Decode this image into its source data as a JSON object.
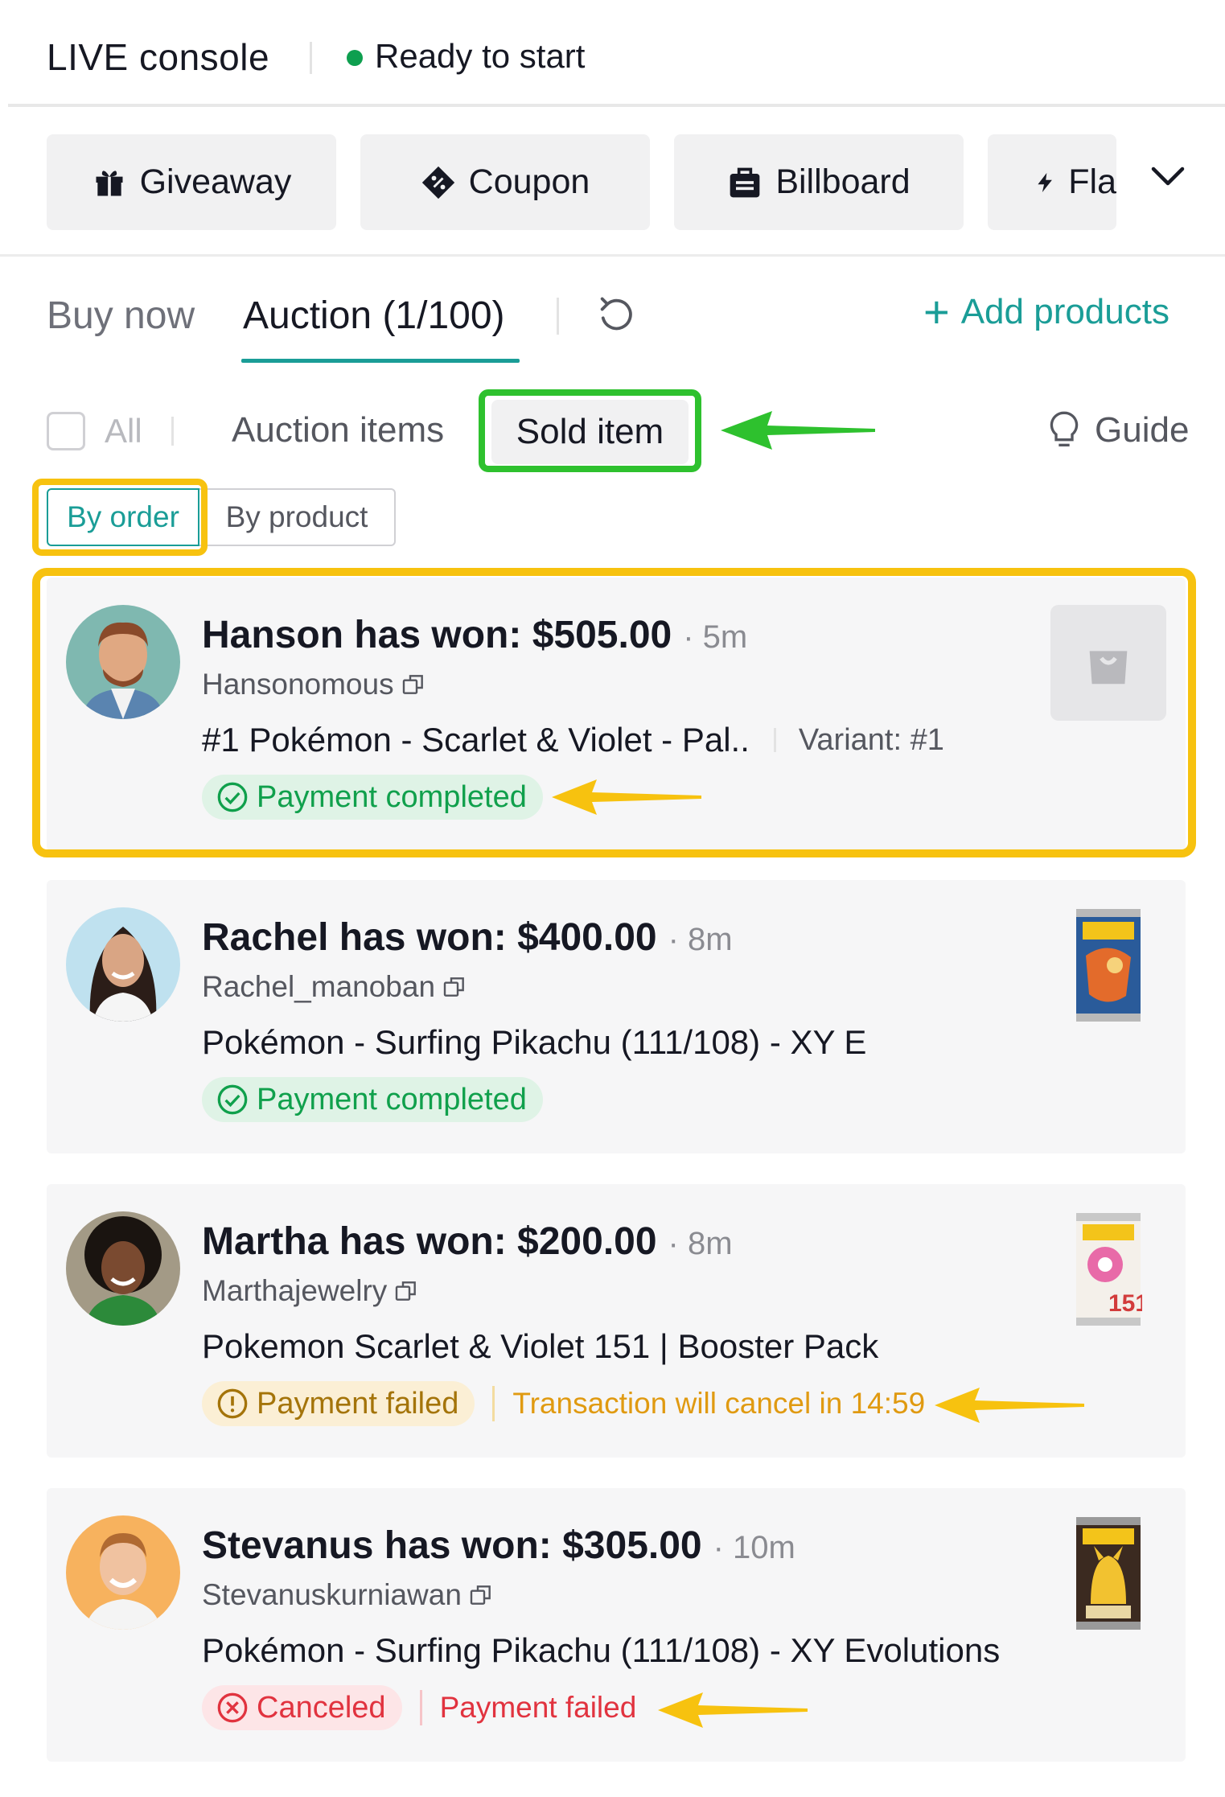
{
  "header": {
    "title": "LIVE console",
    "status": "Ready to start"
  },
  "tools": {
    "giveaway": "Giveaway",
    "coupon": "Coupon",
    "billboard": "Billboard",
    "flash": "Fla"
  },
  "tabs": {
    "buy_now": "Buy now",
    "auction": "Auction (1/100)",
    "add_products": "Add products"
  },
  "filters": {
    "all": "All",
    "auction_items": "Auction items",
    "sold_item": "Sold item",
    "guide": "Guide"
  },
  "sort": {
    "by_order": "By order",
    "by_product": "By product"
  },
  "orders": [
    {
      "title": "Hanson has won: $505.00",
      "time": "· 5m",
      "handle": "Hansonomous",
      "product": "#1 Pokémon - Scarlet & Violet - Pal..",
      "variant": "Variant: #1",
      "status": "Payment completed",
      "note": ""
    },
    {
      "title": "Rachel has won: $400.00",
      "time": "· 8m",
      "handle": "Rachel_manoban",
      "product": "Pokémon - Surfing Pikachu (111/108) - XY E",
      "variant": "",
      "status": "Payment completed",
      "note": ""
    },
    {
      "title": "Martha has won: $200.00",
      "time": "· 8m",
      "handle": "Marthajewelry",
      "product": "Pokemon Scarlet & Violet 151 | Booster Pack",
      "variant": "",
      "status": "Payment failed",
      "note": "Transaction will cancel in 14:59"
    },
    {
      "title": "Stevanus has won: $305.00",
      "time": "· 10m",
      "handle": "Stevanuskurniawan",
      "product": "Pokémon - Surfing Pikachu (111/108) - XY Evolutions",
      "variant": "",
      "status": "Canceled",
      "note": "Payment failed"
    }
  ],
  "colors": {
    "accent": "#1a9d97",
    "success": "#10a04c",
    "warning": "#e09a11",
    "danger": "#e1333f",
    "highlight_green": "#2ec12e",
    "highlight_yellow": "#f7c20f"
  },
  "icons": [
    "giveaway-icon",
    "coupon-icon",
    "billboard-icon",
    "flash-icon",
    "chevron-down-icon",
    "refresh-icon",
    "plus-icon",
    "lightbulb-icon",
    "copy-icon",
    "check-circle-icon",
    "alert-circle-icon",
    "x-circle-icon",
    "shopping-bag-icon"
  ]
}
